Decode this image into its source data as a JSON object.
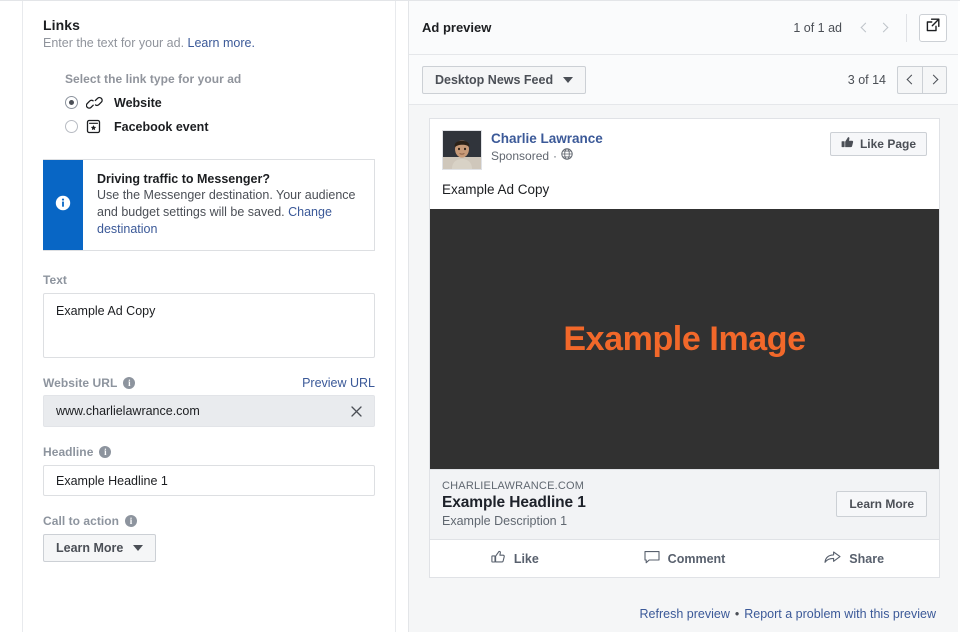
{
  "left": {
    "title": "Links",
    "subtitle_text": "Enter the text for your ad.",
    "learn_more": "Learn more.",
    "link_type": {
      "label": "Select the link type for your ad",
      "options": [
        {
          "label": "Website",
          "icon": "chain-link-icon",
          "selected": true
        },
        {
          "label": "Facebook event",
          "icon": "event-ticket-icon",
          "selected": false
        }
      ]
    },
    "callout": {
      "icon": "info-icon",
      "accent_color": "#0866c5",
      "title": "Driving traffic to Messenger?",
      "body": "Use the Messenger destination. Your audience and budget settings will be saved.",
      "link": "Change destination"
    },
    "text_field": {
      "label": "Text",
      "value": "Example Ad Copy"
    },
    "website_url": {
      "label": "Website URL",
      "info_icon": "info-icon",
      "preview_link": "Preview URL",
      "value": "www.charlielawrance.com",
      "clear_icon": "close-icon"
    },
    "headline": {
      "label": "Headline",
      "info_icon": "info-icon",
      "value": "Example Headline 1"
    },
    "call_to_action": {
      "label": "Call to action",
      "info_icon": "info-icon",
      "value": "Learn More",
      "caret_icon": "chevron-down-icon"
    }
  },
  "right": {
    "header": {
      "title": "Ad preview",
      "count": "1 of 1 ad",
      "prev_icon": "chevron-left-icon",
      "next_icon": "chevron-right-icon",
      "expand_icon": "external-link-icon"
    },
    "subbar": {
      "placement": "Desktop News Feed",
      "placement_caret_icon": "chevron-down-icon",
      "pager_count": "3 of 14",
      "pager_prev_icon": "chevron-left-icon",
      "pager_next_icon": "chevron-right-icon"
    },
    "ad": {
      "avatar": "profile-photo",
      "page_name": "Charlie Lawrance",
      "sponsored": "Sponsored",
      "separator": "·",
      "globe_icon": "globe-icon",
      "like_page_button": "Like Page",
      "like_page_icon": "thumbs-up-icon",
      "body_copy": "Example Ad Copy",
      "image_text": "Example Image",
      "image_bg_color": "#313131",
      "image_text_color": "#f2682a",
      "domain": "CHARLIELAWRANCE.COM",
      "headline": "Example Headline 1",
      "description": "Example Description 1",
      "cta_button": "Learn More",
      "actions": [
        {
          "label": "Like",
          "icon": "thumbs-up-outline-icon"
        },
        {
          "label": "Comment",
          "icon": "comment-bubble-icon"
        },
        {
          "label": "Share",
          "icon": "share-arrow-icon"
        }
      ]
    },
    "footer": {
      "refresh": "Refresh preview",
      "separator": "•",
      "report": "Report a problem with this preview"
    }
  }
}
